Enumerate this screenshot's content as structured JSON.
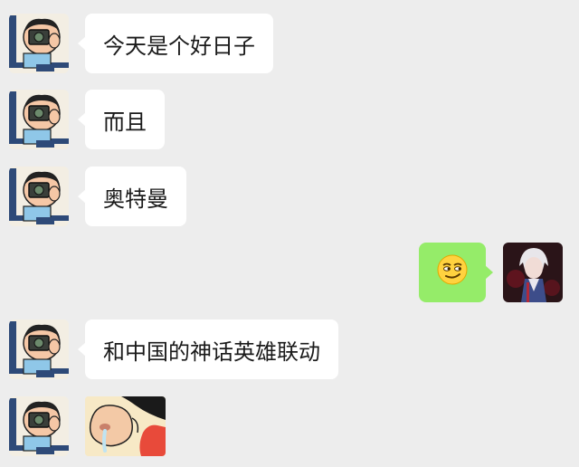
{
  "chat": {
    "colors": {
      "background": "#ededed",
      "incoming_bubble": "#ffffff",
      "outgoing_bubble": "#95ec69",
      "text": "#1a1a1a"
    },
    "messages": [
      {
        "side": "incoming",
        "kind": "text",
        "text": "今天是个好日子",
        "avatar": "shinchan-camera-avatar"
      },
      {
        "side": "incoming",
        "kind": "text",
        "text": "而且",
        "avatar": "shinchan-camera-avatar"
      },
      {
        "side": "incoming",
        "kind": "text",
        "text": "奥特曼",
        "avatar": "shinchan-camera-avatar"
      },
      {
        "side": "outgoing",
        "kind": "emoji",
        "emoji": "smirk-face-emoji",
        "avatar": "white-haired-anime-avatar"
      },
      {
        "side": "incoming",
        "kind": "text",
        "text": "和中国的神话英雄联动",
        "avatar": "shinchan-camera-avatar"
      },
      {
        "side": "incoming",
        "kind": "sticker",
        "sticker": "nose-closeup-sticker",
        "avatar": "shinchan-camera-avatar"
      }
    ]
  }
}
